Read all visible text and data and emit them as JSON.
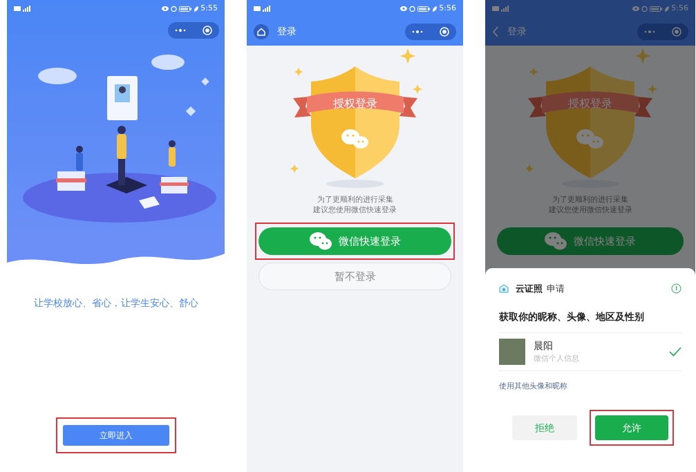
{
  "screens": [
    {
      "kind": "welcome",
      "time": "5:55",
      "slogan": "让学校放心、省心，让学生安心、舒心",
      "button": {
        "label": "立即进入",
        "highlighted": true
      }
    },
    {
      "kind": "login",
      "time": "5:56",
      "nav": {
        "title": "登录",
        "kind": "home"
      },
      "banner": "授权登录",
      "hint": [
        "为了更顺利的进行采集",
        "建议您使用微信快速登录"
      ],
      "buttons": [
        {
          "kind": "wechat",
          "label": "微信快速登录",
          "highlighted": true
        },
        {
          "kind": "skip",
          "label": "暂不登录",
          "highlighted": false
        }
      ],
      "dimmed": false
    },
    {
      "kind": "login",
      "time": "5:56",
      "nav": {
        "title": "登录",
        "kind": "arrow"
      },
      "banner": "授权登录",
      "hint": [
        "为了更顺利的进行采集",
        "建议您使用微信快速登录"
      ],
      "buttons": [
        {
          "kind": "wechat",
          "label": "微信快速登录",
          "highlighted": false
        }
      ],
      "dimmed": true,
      "sheet": {
        "app_name": "云证照",
        "action": "申请",
        "title": "获取你的昵称、头像、地区及性别",
        "accounts": [
          {
            "name": "晨阳",
            "subtitle": "微信个人信息",
            "selected": true
          }
        ],
        "alt_link": "使用其他头像和昵称",
        "buttons": [
          {
            "kind": "reject",
            "label": "拒绝",
            "highlighted": false
          },
          {
            "kind": "allow",
            "label": "允许",
            "highlighted": true
          }
        ]
      }
    }
  ]
}
